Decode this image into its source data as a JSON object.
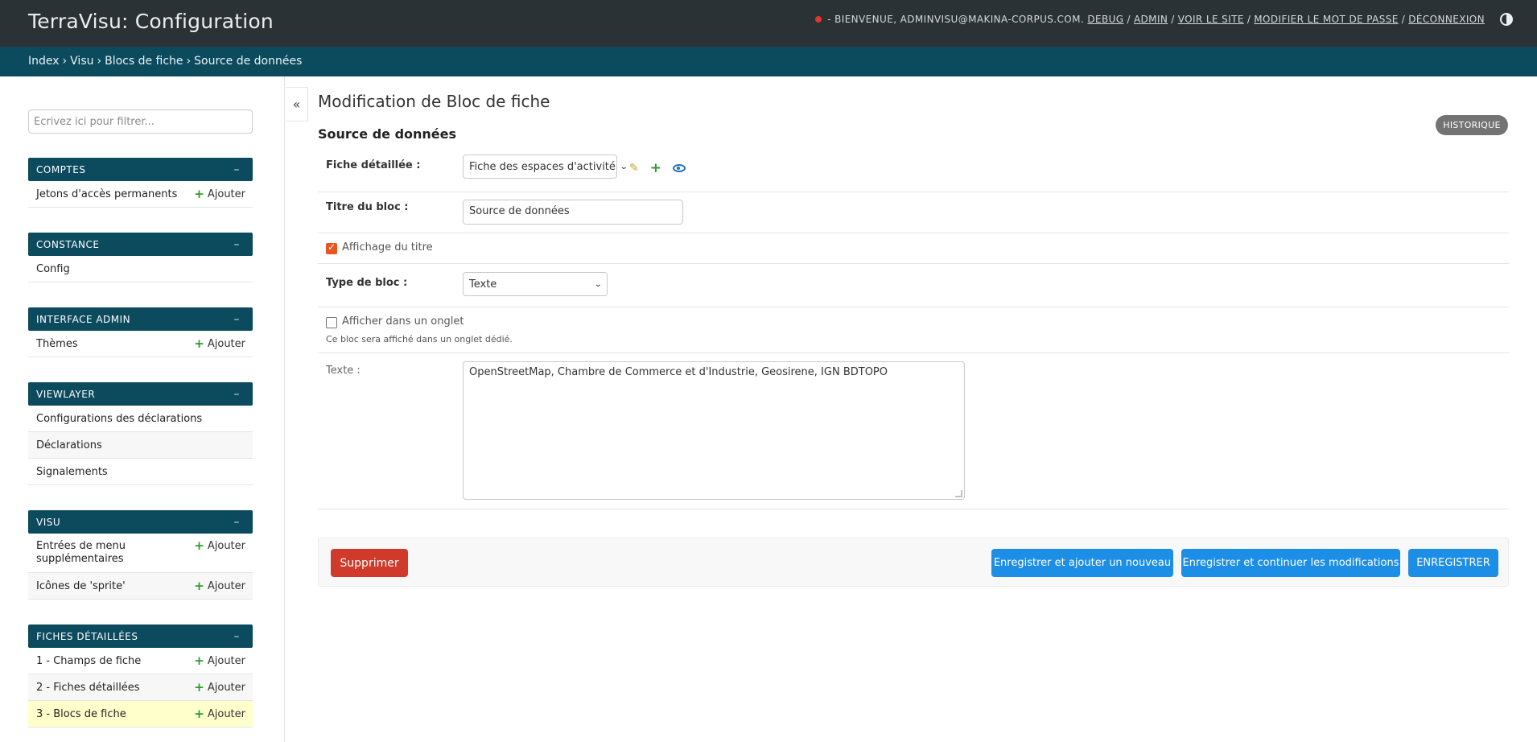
{
  "header": {
    "brand": "TerraVisu: Configuration",
    "welcome": "- BIENVENUE, ADMINVISU@MAKINA-CORPUS.COM.",
    "links": [
      "DEBUG",
      "ADMIN",
      "VOIR LE SITE",
      "MODIFIER LE MOT DE PASSE",
      "DÉCONNEXION"
    ],
    "status_dot_color": "#e0392b"
  },
  "breadcrumbs": [
    "Index",
    "Visu",
    "Blocs de fiche",
    "Source de données"
  ],
  "sidebar": {
    "filter_placeholder": "Écrivez ici pour filtrer...",
    "toggle_label": "«",
    "collapse_label": "–",
    "add_label": "Ajouter",
    "modules": [
      {
        "title": "COMPTES",
        "items": [
          {
            "label": "Jetons d'accès permanents",
            "add": true
          }
        ]
      },
      {
        "title": "CONSTANCE",
        "items": [
          {
            "label": "Config",
            "add": false
          }
        ]
      },
      {
        "title": "INTERFACE ADMIN",
        "items": [
          {
            "label": "Thèmes",
            "add": true
          }
        ]
      },
      {
        "title": "VIEWLAYER",
        "items": [
          {
            "label": "Configurations des déclarations",
            "add": false
          },
          {
            "label": "Déclarations",
            "add": false
          },
          {
            "label": "Signalements",
            "add": false
          }
        ]
      },
      {
        "title": "VISU",
        "items": [
          {
            "label": "Entrées de menu supplémentaires",
            "add": true
          },
          {
            "label": "Icônes de 'sprite'",
            "add": true
          }
        ]
      },
      {
        "title": "FICHES DÉTAILLÉES",
        "items": [
          {
            "label": "1 - Champs de fiche",
            "add": true
          },
          {
            "label": "2 - Fiches détaillées",
            "add": true
          },
          {
            "label": "3 - Blocs de fiche",
            "add": true,
            "current": true
          }
        ]
      }
    ]
  },
  "main": {
    "page_title": "Modification de Bloc de fiche",
    "object_title": "Source de données",
    "history_label": "HISTORIQUE",
    "form": {
      "fiche_label": "Fiche détaillée :",
      "fiche_value": "Fiche des espaces d'activité",
      "titre_label": "Titre du bloc :",
      "titre_value": "Source de données",
      "affichage_label": "Affichage du titre",
      "affichage_checked": true,
      "type_label": "Type de bloc :",
      "type_value": "Texte",
      "onglet_label": "Afficher dans un onglet",
      "onglet_checked": false,
      "onglet_help": "Ce bloc sera affiché dans un onglet dédié.",
      "texte_label": "Texte :",
      "texte_value": "OpenStreetMap, Chambre de Commerce et d'Industrie, Geosirene, IGN BDTOPO"
    },
    "buttons": {
      "delete": "Supprimer",
      "save_add": "Enregistrer et ajouter un nouveau",
      "save_continue": "Enregistrer et continuer les modifications",
      "save": "ENREGISTRER"
    }
  },
  "colors": {
    "header_bg": "#2a3236",
    "module_bg": "#0c4b5e",
    "primary_button": "#1d8ee6",
    "delete_button": "#cf3a2b",
    "current_row": "#ffffcc"
  }
}
